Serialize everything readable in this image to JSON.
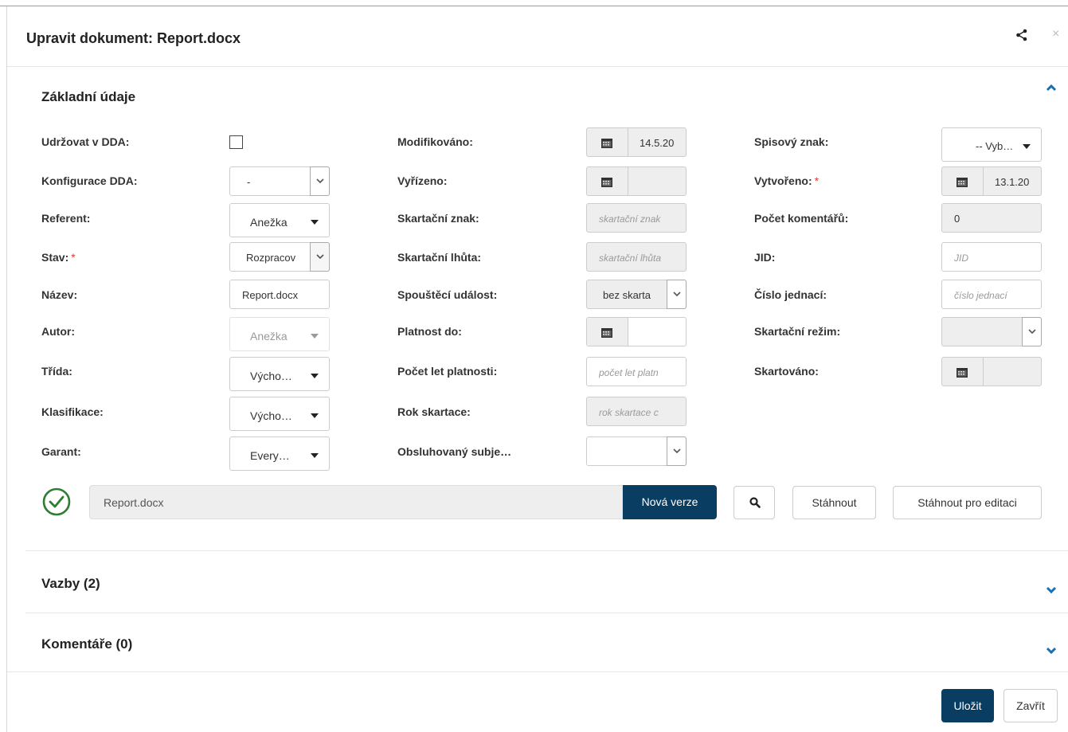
{
  "modal": {
    "title": "Upravit dokument: Report.docx"
  },
  "sections": {
    "basic": "Základní údaje",
    "links": "Vazby (2)",
    "comments": "Komentáře (0)"
  },
  "col1": {
    "dda_keep_label": "Udržovat v DDA:",
    "dda_config_label": "Konfigurace DDA:",
    "dda_config_value": "-",
    "referent_label": "Referent:",
    "referent_value": "Anežka",
    "state_label": "Stav:",
    "state_value": "Rozpracov",
    "name_label": "Název:",
    "name_value": "Report.docx",
    "author_label": "Autor:",
    "author_value": "Anežka",
    "class_label": "Třída:",
    "class_value": "Výcho…",
    "classification_label": "Klasifikace:",
    "classification_value": "Výcho…",
    "guarantor_label": "Garant:",
    "guarantor_value": "Every…",
    "required_mark": "*"
  },
  "col2": {
    "modified_label": "Modifikováno:",
    "modified_value": "14.5.20",
    "resolved_label": "Vyřízeno:",
    "resolved_value": "",
    "shred_mark_label": "Skartační znak:",
    "shred_mark_placeholder": "skartační znak",
    "shred_period_label": "Skartační lhůta:",
    "shred_period_placeholder": "skartační lhůta",
    "trigger_label": "Spouštěcí událost:",
    "trigger_value": "bez skarta",
    "valid_until_label": "Platnost do:",
    "validity_years_label": "Počet let platnosti:",
    "validity_years_placeholder": "počet let platn",
    "shred_year_label": "Rok skartace:",
    "shred_year_placeholder": "rok skartace c",
    "served_subject_label": "Obsluhovaný subje…"
  },
  "col3": {
    "file_mark_label": "Spisový znak:",
    "file_mark_value": "-- Vyb…",
    "created_label": "Vytvořeno:",
    "created_value": "13.1.20",
    "comments_count_label": "Počet komentářů:",
    "comments_count_value": "0",
    "jid_label": "JID:",
    "jid_placeholder": "JID",
    "ref_number_label": "Číslo jednací:",
    "ref_number_placeholder": "číslo jednací",
    "shred_mode_label": "Skartační režim:",
    "shredded_label": "Skartováno:"
  },
  "file": {
    "name": "Report.docx",
    "new_version": "Nová verze",
    "download": "Stáhnout",
    "download_edit": "Stáhnout pro editaci"
  },
  "footer": {
    "save": "Uložit",
    "close": "Zavřít"
  },
  "colors": {
    "primary": "#0a3d62",
    "accent": "#1a6fb0",
    "success": "#2e7d32",
    "required": "#e53935"
  }
}
